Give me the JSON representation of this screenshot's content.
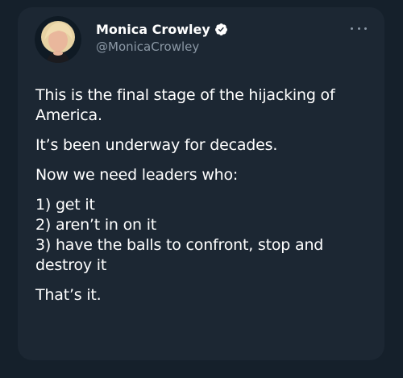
{
  "author": {
    "display_name": "Monica Crowley",
    "handle": "@MonicaCrowley"
  },
  "tweet": {
    "p1": "This is the final stage of the hijacking of America.",
    "p2": "It’s been underway for decades.",
    "p3": "Now we need leaders who:",
    "list": [
      "1) get it",
      "2) aren’t in on it",
      "3) have the balls to confront, stop and destroy it"
    ],
    "p4": "That’s it."
  },
  "icons": {
    "verified": "verified-badge-icon",
    "more": "more-options-icon"
  },
  "colors": {
    "background": "#15202b",
    "card": "#1c2733",
    "text": "#ffffff",
    "secondary": "#8b98a5",
    "verified": "#ffffff"
  }
}
